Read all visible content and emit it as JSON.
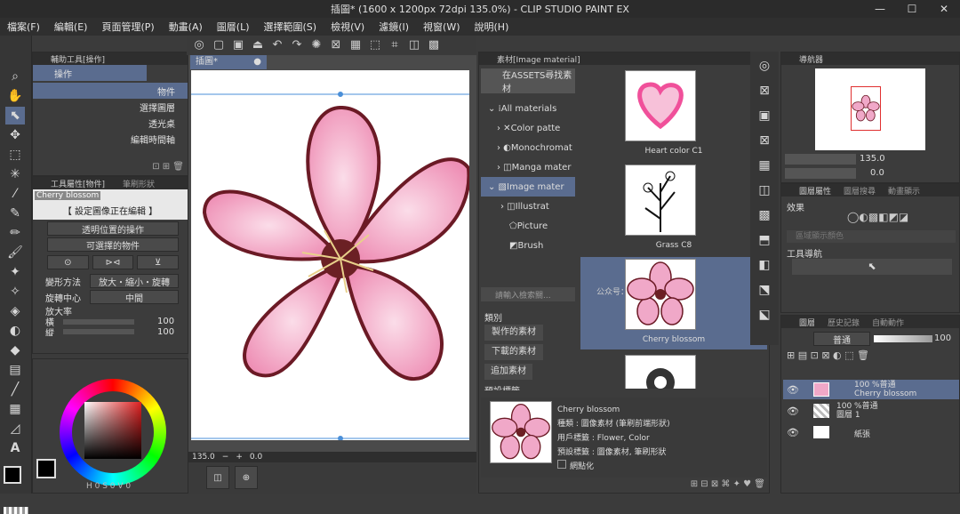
{
  "title": "插圖* (1600 x 1200px 72dpi 135.0%) - CLIP STUDIO PAINT EX",
  "menu": [
    "檔案(F)",
    "編輯(E)",
    "頁面管理(P)",
    "動畫(A)",
    "圖層(L)",
    "選擇範圍(S)",
    "檢視(V)",
    "濾鏡(I)",
    "視窗(W)",
    "說明(H)"
  ],
  "subtool": {
    "header": "輔助工具[操作]",
    "group": "操作",
    "items": [
      "物件",
      "選擇圖層",
      "透光桌",
      "編輯時間軸"
    ]
  },
  "toolprop": {
    "header": "工具屬性[物件]",
    "header2": "筆刷形狀",
    "preview_name": "Cherry blossom",
    "notice": "【 設定圖像正在編輯 】",
    "opt1": "透明位置的操作",
    "opt2": "可選擇的物件",
    "transform_label": "變形方法",
    "transform_value": "放大・縮小・旋轉",
    "center_label": "旋轉中心",
    "center_value": "中間",
    "scale_label": "放大率",
    "h_label": "橫",
    "h_val": "100",
    "v_label": "縱",
    "v_val": "100"
  },
  "canvas": {
    "tab": "插圖*",
    "zoom": "135.0",
    "angle": "0.0"
  },
  "material": {
    "header": "素材[Image material]",
    "search_assets": "在ASSETS尋找素材",
    "tree": [
      "All materials",
      "Color patte",
      "Monochromat",
      "Manga mater",
      "Image mater",
      "Illustrat",
      "Picture",
      "Brush"
    ],
    "search_placeholder": "請輸入檢索關...",
    "category": "類別",
    "cat_items": [
      "製作的素材",
      "下載的素材",
      "追加素材"
    ],
    "preset": "預設標籤",
    "thumbs": [
      "Heart color C1",
      "Grass C8",
      "Cherry blossom"
    ],
    "detail_name": "Cherry blossom",
    "detail_type": "種類 : 圖像素材 (筆刷前端形狀)",
    "detail_user": "用戶標籤 : Flower, Color",
    "detail_preset": "預設標籤 : 圖像素材, 筆刷形狀",
    "tile": "網點化"
  },
  "navigator": {
    "header": "導航器",
    "zoom": "135.0",
    "angle": "0.0"
  },
  "layerprop": {
    "header": "圖層屬性",
    "tab2": "圖層搜尋",
    "tab3": "動畫顯示",
    "effect": "效果",
    "area": "區域顯示顏色",
    "toolnav": "工具導航"
  },
  "layers": {
    "header": "圖層",
    "tab2": "歷史記錄",
    "tab3": "自動動作",
    "blend": "普通",
    "opacity": "100",
    "items": [
      {
        "mode": "100 %普通",
        "name": "Cherry blossom"
      },
      {
        "mode": "100 %普通",
        "name": "圖層 1"
      },
      {
        "mode": "",
        "name": "紙張"
      }
    ]
  },
  "watermark": "公众号：",
  "colors": {
    "accent": "#5a6c8f",
    "flower": "#f0a8c8"
  }
}
